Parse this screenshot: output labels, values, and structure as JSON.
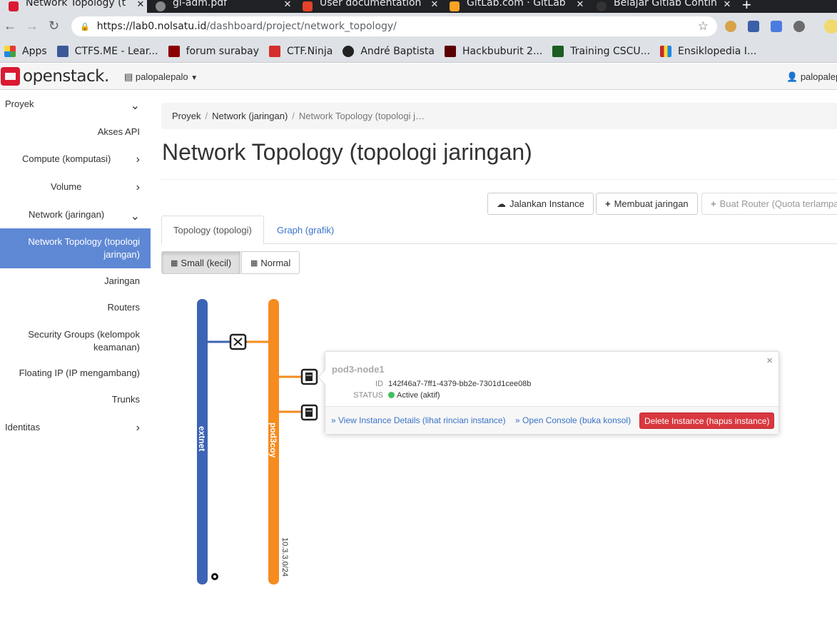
{
  "browser": {
    "tabs": [
      {
        "title": "Network Topology (t",
        "active": true
      },
      {
        "title": "gl-adm.pdf",
        "active": false
      },
      {
        "title": "User documentation",
        "active": false
      },
      {
        "title": "GitLab.com · GitLab",
        "active": false
      },
      {
        "title": "Belajar Gitlab Contin",
        "active": false
      }
    ],
    "url_host": "https://lab0.nolsatu.id",
    "url_path": "/dashboard/project/network_topology/",
    "bookmarks": [
      {
        "label": "Apps",
        "color": "#e53935"
      },
      {
        "label": "CTFS.ME - Lear...",
        "color": "#3b5998"
      },
      {
        "label": "forum surabay",
        "color": "#8b0000"
      },
      {
        "label": "CTF.Ninja",
        "color": "#d32f2f"
      },
      {
        "label": "André Baptista",
        "color": "#222222"
      },
      {
        "label": "Hackbuburit 2...",
        "color": "#5a0000"
      },
      {
        "label": "Training CSCU...",
        "color": "#1b5e20"
      },
      {
        "label": "Ensiklopedia I...",
        "color": "#c62828"
      }
    ]
  },
  "header": {
    "logo_text": "openstack.",
    "project": "palopalepalo",
    "user": "palopalepalo"
  },
  "sidebar": {
    "items": [
      {
        "label": "Proyek",
        "chevron": "down"
      },
      {
        "label": "Akses API",
        "chevron": ""
      },
      {
        "label": "Compute (komputasi)",
        "chevron": "right"
      },
      {
        "label": "Volume",
        "chevron": "right"
      },
      {
        "label": "Network (jaringan)",
        "chevron": "down"
      },
      {
        "label": "Network Topology (topologi jaringan)",
        "chevron": "",
        "active": true
      },
      {
        "label": "Jaringan",
        "chevron": ""
      },
      {
        "label": "Routers",
        "chevron": ""
      },
      {
        "label": "Security Groups (kelompok keamanan)",
        "chevron": ""
      },
      {
        "label": "Floating IP (IP mengambang)",
        "chevron": ""
      },
      {
        "label": "Trunks",
        "chevron": ""
      },
      {
        "label": "Identitas",
        "chevron": "right"
      }
    ]
  },
  "breadcrumb": [
    "Proyek",
    "Network (jaringan)",
    "Network Topology (topologi j…"
  ],
  "page_title": "Network Topology (topologi jaringan)",
  "actions": {
    "launch_instance": "Jalankan Instance",
    "create_network": "Membuat jaringan",
    "create_router": "Buat Router (Quota terlampau"
  },
  "tabs": {
    "topology": "Topology (topologi)",
    "graph": "Graph (grafik)"
  },
  "view_toggle": {
    "small": "Small (kecil)",
    "normal": "Normal"
  },
  "topology": {
    "networks": [
      {
        "name": "extnet",
        "color": "#3d63b5",
        "subnet": ""
      },
      {
        "name": "pod3coy",
        "color": "#f68b1f",
        "subnet": "10.3.3.0/24"
      }
    ]
  },
  "instance_popup": {
    "name": "pod3-node1",
    "id_label": "ID",
    "id_value": "142f46a7-7ff1-4379-bb2e-7301d1cee08b",
    "status_label": "STATUS",
    "status_value": "Active (aktif)",
    "status_color": "#3fbf5f",
    "view_details": "» View Instance Details (lihat rincian instance)",
    "open_console": "» Open Console (buka konsol)",
    "delete": "Delete Instance (hapus instance)",
    "close": "×"
  }
}
